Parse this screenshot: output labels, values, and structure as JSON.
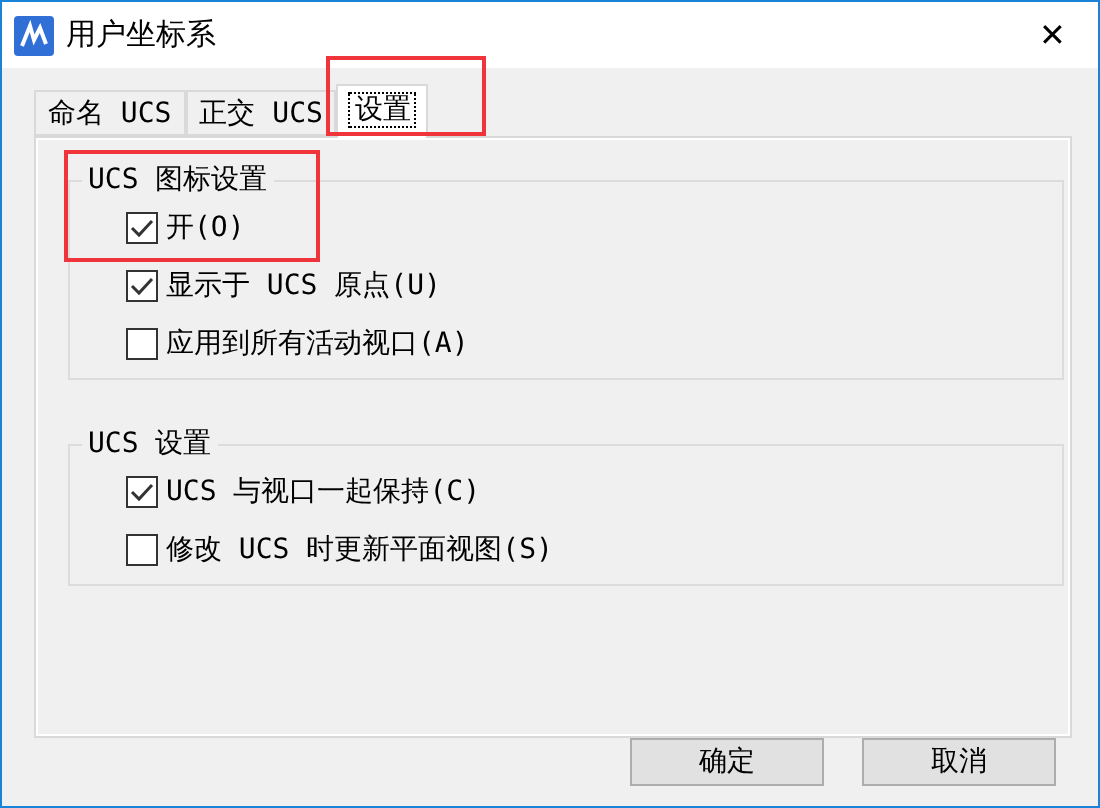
{
  "window": {
    "title": "用户坐标系",
    "close": "✕"
  },
  "tabs": [
    {
      "label": "命名 UCS",
      "selected": false,
      "highlighted": false
    },
    {
      "label": "正交 UCS",
      "selected": false,
      "highlighted": false
    },
    {
      "label": "设置",
      "selected": true,
      "highlighted": true
    }
  ],
  "groups": [
    {
      "title": "UCS 图标设置",
      "highlighted": true,
      "options": [
        {
          "label": "开(O)",
          "checked": true
        },
        {
          "label": "显示于 UCS 原点(U)",
          "checked": true
        },
        {
          "label": "应用到所有活动视口(A)",
          "checked": false
        }
      ]
    },
    {
      "title": "UCS 设置",
      "highlighted": false,
      "options": [
        {
          "label": "UCS 与视口一起保持(C)",
          "checked": true
        },
        {
          "label": "修改 UCS 时更新平面视图(S)",
          "checked": false
        }
      ]
    }
  ],
  "buttons": [
    "确定",
    "取消"
  ]
}
